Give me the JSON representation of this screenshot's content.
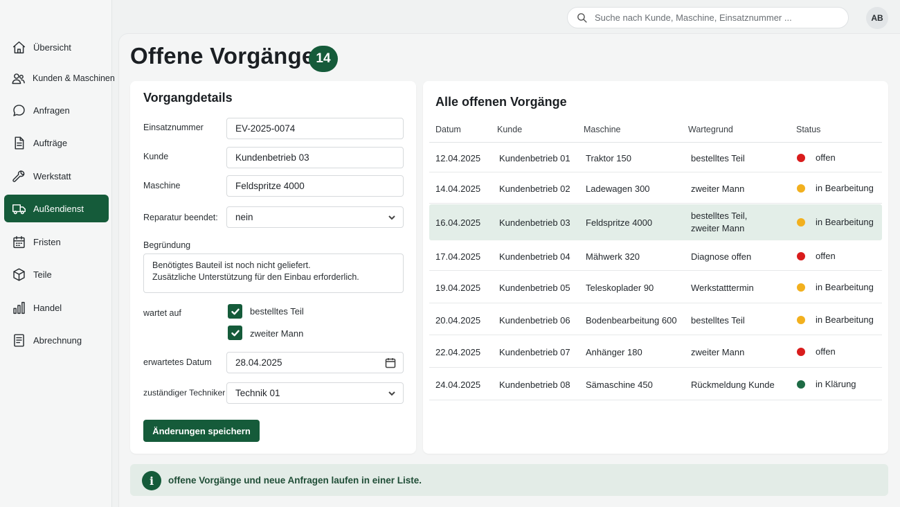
{
  "sidebar": {
    "items": [
      {
        "label": "Übersicht",
        "icon": "home-icon",
        "active": false
      },
      {
        "label": "Kunden & Maschinen",
        "icon": "users-icon",
        "active": false
      },
      {
        "label": "Anfragen",
        "icon": "chat-bubble-icon",
        "active": false
      },
      {
        "label": "Aufträge",
        "icon": "document-icon",
        "active": false
      },
      {
        "label": "Werkstatt",
        "icon": "wrench-icon",
        "active": false
      },
      {
        "label": "Außendienst",
        "icon": "truck-icon",
        "active": true
      },
      {
        "label": "Fristen",
        "icon": "calendar-icon",
        "active": false
      },
      {
        "label": "Teile",
        "icon": "box-icon",
        "active": false
      },
      {
        "label": "Handel",
        "icon": "bar-chart-icon",
        "active": false
      },
      {
        "label": "Abrechnung",
        "icon": "receipt-icon",
        "active": false
      }
    ]
  },
  "topbar": {
    "search_placeholder": "Suche nach Kunde, Maschine, Einsatznummer ...",
    "avatar_initials": "AB"
  },
  "page": {
    "title": "Offene Vorgänge",
    "count": "14"
  },
  "details": {
    "title": "Vorgangdetails",
    "einsatznummer_label": "Einsatznummer",
    "einsatznummer_value": "EV-2025-0074",
    "kunde_label": "Kunde",
    "kunde_value": "Kundenbetrieb 03",
    "maschine_label": "Maschine",
    "maschine_value": "Feldspritze 4000",
    "reparatur_label": "Reparatur beendet:",
    "reparatur_value": "nein",
    "begruendung_label": "Begründung",
    "begruendung_line1": "Benötigtes Bauteil ist noch nicht geliefert.",
    "begruendung_line2": "Zusätzliche Unterstützung für den Einbau erforderlich.",
    "wartet_label": "wartet auf",
    "wartet_option1": "bestelltes Teil",
    "wartet_option2": "zweiter Mann",
    "datum_label": "erwartetes Datum",
    "datum_value": "28.04.2025",
    "techniker_label": "zuständiger Techniker",
    "techniker_value": "Technik 01",
    "save_label": "Änderungen speichern"
  },
  "table": {
    "title": "Alle offenen Vorgänge",
    "headers": [
      "Datum",
      "Kunde",
      "Maschine",
      "Wartegrund",
      "Status"
    ],
    "rows": [
      {
        "datum": "12.04.2025",
        "kunde": "Kundenbetrieb 01",
        "maschine": "Traktor 150",
        "grund1": "bestelltes Teil",
        "grund2": "",
        "status": "offen",
        "color": "#d91c1c"
      },
      {
        "datum": "14.04.2025",
        "kunde": "Kundenbetrieb 02",
        "maschine": "Ladewagen 300",
        "grund1": "zweiter Mann",
        "grund2": "",
        "status": "in Bearbeitung",
        "color": "#f2b01e"
      },
      {
        "datum": "16.04.2025",
        "kunde": "Kundenbetrieb 03",
        "maschine": "Feldspritze 4000",
        "grund1": "bestelltes Teil,",
        "grund2": "zweiter Mann",
        "status": "in Bearbeitung",
        "color": "#f2b01e"
      },
      {
        "datum": "17.04.2025",
        "kunde": "Kundenbetrieb 04",
        "maschine": "Mähwerk 320",
        "grund1": "Diagnose offen",
        "grund2": "",
        "status": "offen",
        "color": "#d91c1c"
      },
      {
        "datum": "19.04.2025",
        "kunde": "Kundenbetrieb 05",
        "maschine": "Teleskoplader 90",
        "grund1": "Werkstatttermin",
        "grund2": "",
        "status": "in Bearbeitung",
        "color": "#f2b01e"
      },
      {
        "datum": "20.04.2025",
        "kunde": "Kundenbetrieb 06",
        "maschine": "Bodenbearbeitung 600",
        "grund1": "bestelltes Teil",
        "grund2": "",
        "status": "in Bearbeitung",
        "color": "#f2b01e"
      },
      {
        "datum": "22.04.2025",
        "kunde": "Kundenbetrieb 07",
        "maschine": "Anhänger 180",
        "grund1": "zweiter Mann",
        "grund2": "",
        "status": "offen",
        "color": "#d91c1c"
      },
      {
        "datum": "24.04.2025",
        "kunde": "Kundenbetrieb 08",
        "maschine": "Sämaschine 450",
        "grund1": "Rückmeldung Kunde",
        "grund2": "",
        "status": "in Klärung",
        "color": "#1e6b45"
      }
    ]
  },
  "banner": {
    "icon": "info-icon",
    "text": "offene Vorgänge und neue Anfragen laufen in einer Liste."
  },
  "colors": {
    "accent": "#155b3a"
  }
}
